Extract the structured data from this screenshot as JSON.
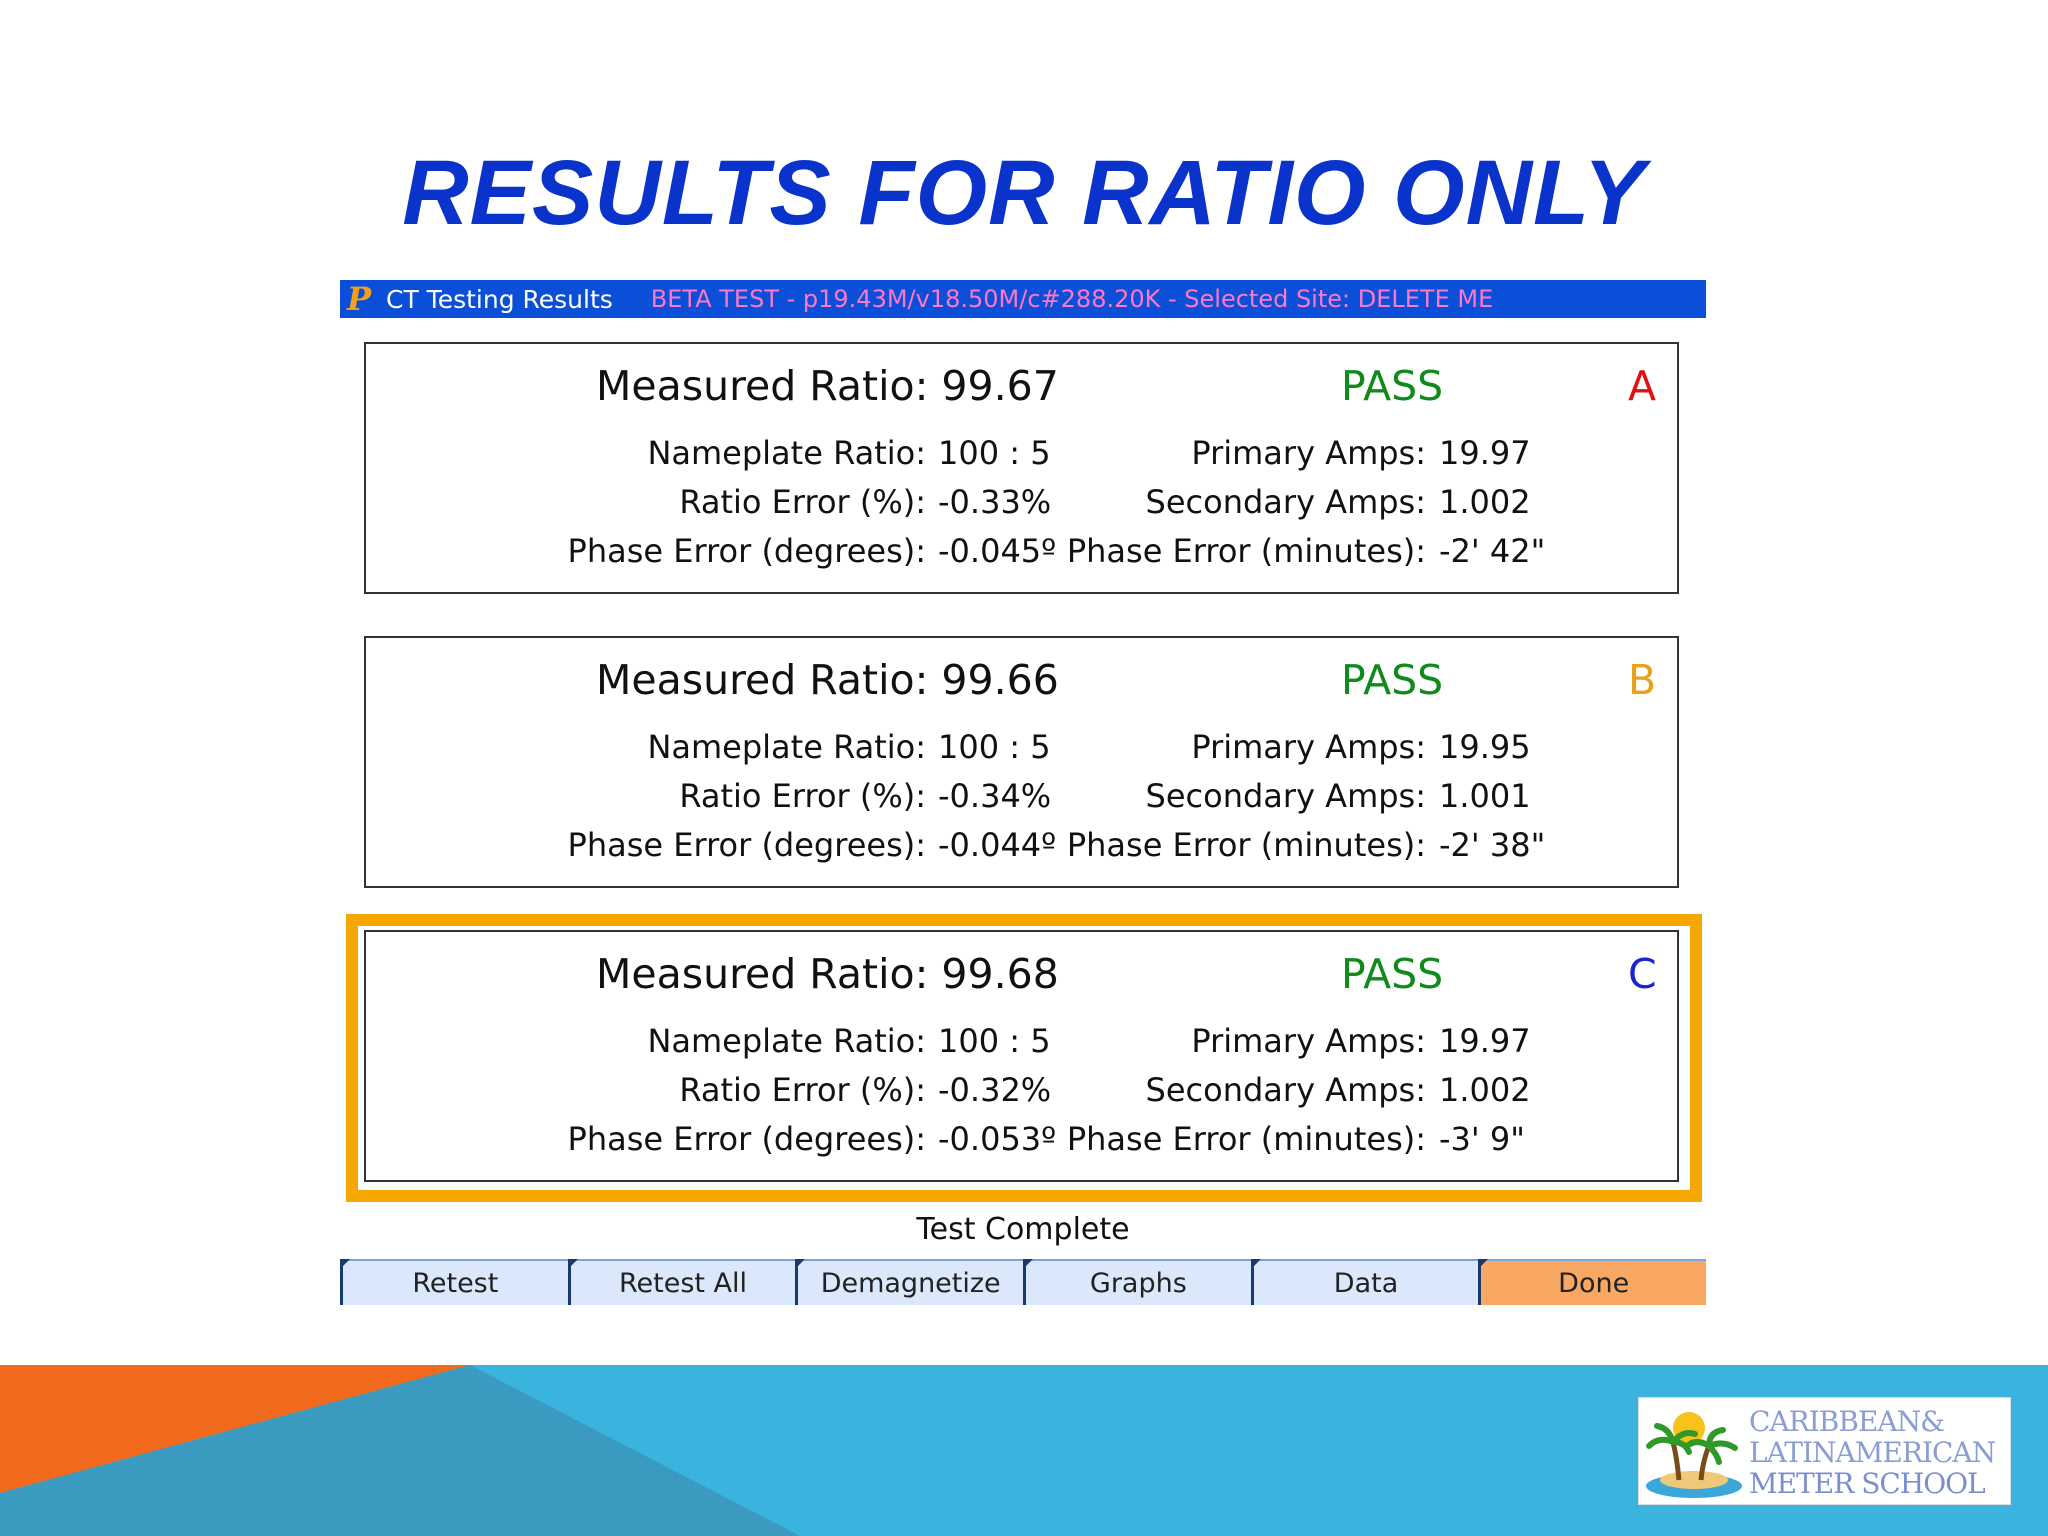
{
  "slide": {
    "title": "RESULTS FOR RATIO ONLY"
  },
  "app": {
    "title": "CT Testing Results",
    "beta_info": "BETA TEST - p19.43M/v18.50M/c#288.20K - Selected Site: DELETE ME",
    "logo_letter": "P"
  },
  "results": [
    {
      "measured": "Measured Ratio: 99.67",
      "status": "PASS",
      "phase": "A",
      "phase_color": "#e01010",
      "nameplate_label": "Nameplate Ratio:",
      "nameplate": "100 : 5",
      "ratio_error_label": "Ratio Error (%):",
      "ratio_error": "-0.33%",
      "phase_deg_label": "Phase Error (degrees):",
      "phase_deg": "-0.045º",
      "primary_label": "Primary Amps:",
      "primary": "19.97",
      "secondary_label": "Secondary Amps:",
      "secondary": "1.002",
      "phase_min_label": "Phase Error (minutes):",
      "phase_min": "-2' 42\""
    },
    {
      "measured": "Measured Ratio: 99.66",
      "status": "PASS",
      "phase": "B",
      "phase_color": "#e8a21a",
      "nameplate_label": "Nameplate Ratio:",
      "nameplate": "100 : 5",
      "ratio_error_label": "Ratio Error (%):",
      "ratio_error": "-0.34%",
      "phase_deg_label": "Phase Error (degrees):",
      "phase_deg": "-0.044º",
      "primary_label": "Primary Amps:",
      "primary": "19.95",
      "secondary_label": "Secondary Amps:",
      "secondary": "1.001",
      "phase_min_label": "Phase Error (minutes):",
      "phase_min": "-2' 38\""
    },
    {
      "measured": "Measured Ratio: 99.68",
      "status": "PASS",
      "phase": "C",
      "phase_color": "#1a22d6",
      "nameplate_label": "Nameplate Ratio:",
      "nameplate": "100 : 5",
      "ratio_error_label": "Ratio Error (%):",
      "ratio_error": "-0.32%",
      "phase_deg_label": "Phase Error (degrees):",
      "phase_deg": "-0.053º",
      "primary_label": "Primary Amps:",
      "primary": "19.97",
      "secondary_label": "Secondary Amps:",
      "secondary": "1.002",
      "phase_min_label": "Phase Error (minutes):",
      "phase_min": "-3' 9\""
    }
  ],
  "status_text": "Test Complete",
  "buttons": [
    "Retest",
    "Retest All",
    "Demagnetize",
    "Graphs",
    "Data",
    "Done"
  ],
  "logo": {
    "line1": "CARIBBEAN&",
    "line2": "LATINAMERICAN",
    "line3": "METER SCHOOL"
  },
  "colors": {
    "title": "#0a33cc",
    "pass": "#118a1c",
    "selection": "#f6a700",
    "done_button": "#f8a862",
    "band_blue": "#3ab4de",
    "band_orange": "#f26a1e"
  }
}
